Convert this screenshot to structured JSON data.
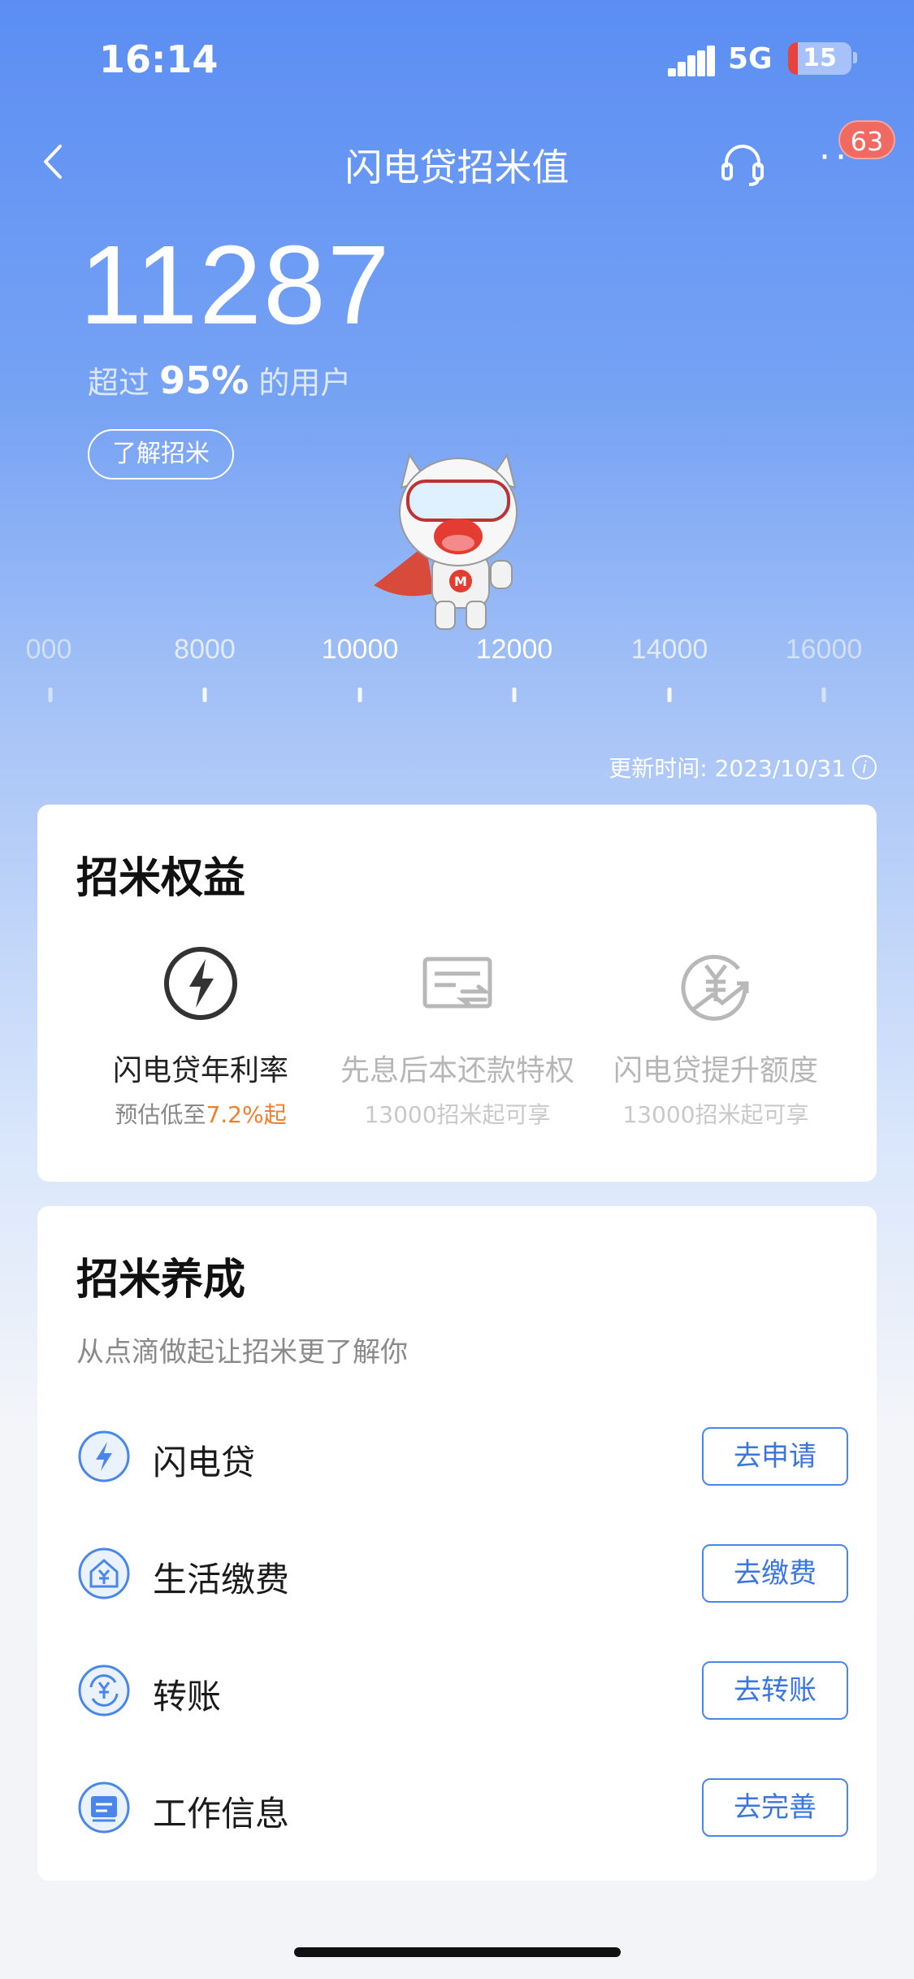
{
  "status_bar": {
    "time": "16:14",
    "network": "5G",
    "battery_percent": "15",
    "battery_level": 0.15
  },
  "nav": {
    "title": "闪电贷招米值",
    "notification_count": "63",
    "icons": {
      "back": "chevron-left-icon",
      "service": "headset-icon",
      "more": "more-dots-icon"
    }
  },
  "score": {
    "value": "11287",
    "rank_prefix": "超过",
    "rank_percent": "95%",
    "rank_suffix": "的用户",
    "learn_button": "了解招米"
  },
  "scale": {
    "labels": [
      "000",
      "8000",
      "10000",
      "12000",
      "14000",
      "16000"
    ]
  },
  "update": {
    "text": "更新时间: 2023/10/31"
  },
  "benefits": {
    "title": "招米权益",
    "items": [
      {
        "name": "闪电贷年利率",
        "sub_prefix": "预估低至",
        "sub_highlight": "7.2%起",
        "icon": "lightning-circle-icon",
        "enabled": true
      },
      {
        "name": "先息后本还款特权",
        "sub": "13000招米起可享",
        "icon": "card-exchange-icon",
        "enabled": false
      },
      {
        "name": "闪电贷提升额度",
        "sub": "13000招米起可享",
        "icon": "yuan-growth-icon",
        "enabled": false
      }
    ]
  },
  "cultivate": {
    "title": "招米养成",
    "subtitle": "从点滴做起让招米更了解你",
    "tasks": [
      {
        "label": "闪电贷",
        "button": "去申请",
        "icon": "lightning-icon"
      },
      {
        "label": "生活缴费",
        "button": "去缴费",
        "icon": "home-yuan-icon"
      },
      {
        "label": "转账",
        "button": "去转账",
        "icon": "transfer-yuan-icon"
      },
      {
        "label": "工作信息",
        "button": "去完善",
        "icon": "id-card-icon"
      }
    ]
  },
  "colors": {
    "accent": "#3a76e0",
    "highlight": "#f07e2c",
    "badge": "#f06a62"
  }
}
